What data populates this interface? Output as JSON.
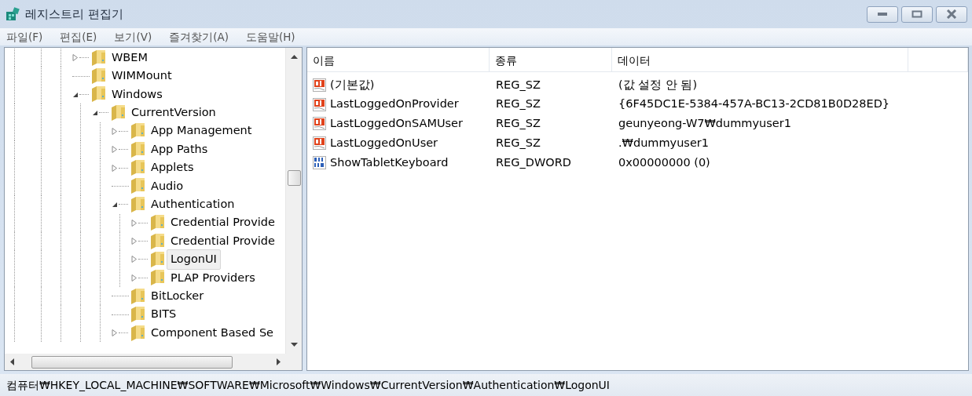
{
  "window": {
    "title": "레지스트리 편집기"
  },
  "menu": [
    "파일(F)",
    "편집(E)",
    "보기(V)",
    "즐겨찾기(A)",
    "도움말(H)"
  ],
  "tree": [
    {
      "label": "WBEM",
      "kind": "folder",
      "expanded": false,
      "selected": false
    },
    {
      "label": "WIMMount",
      "kind": "leaf",
      "selected": false
    },
    {
      "label": "Windows",
      "kind": "folder",
      "expanded": true,
      "selected": false,
      "children": [
        {
          "label": "CurrentVersion",
          "kind": "folder",
          "expanded": true,
          "selected": false,
          "children": [
            {
              "label": "App Management",
              "kind": "folder",
              "expanded": false,
              "selected": false
            },
            {
              "label": "App Paths",
              "kind": "folder",
              "expanded": false,
              "selected": false
            },
            {
              "label": "Applets",
              "kind": "folder",
              "expanded": false,
              "selected": false
            },
            {
              "label": "Audio",
              "kind": "leaf",
              "selected": false
            },
            {
              "label": "Authentication",
              "kind": "folder",
              "expanded": true,
              "selected": false,
              "children": [
                {
                  "label": "Credential Provide",
                  "kind": "folder",
                  "expanded": false,
                  "selected": false
                },
                {
                  "label": "Credential Provide",
                  "kind": "folder",
                  "expanded": false,
                  "selected": false
                },
                {
                  "label": "LogonUI",
                  "kind": "folder",
                  "expanded": false,
                  "selected": true
                },
                {
                  "label": "PLAP Providers",
                  "kind": "folder",
                  "expanded": false,
                  "selected": false
                }
              ]
            },
            {
              "label": "BitLocker",
              "kind": "leaf",
              "selected": false
            },
            {
              "label": "BITS",
              "kind": "leaf",
              "selected": false
            },
            {
              "label": "Component Based Se",
              "kind": "folder",
              "expanded": false,
              "selected": false
            }
          ]
        }
      ]
    }
  ],
  "values": {
    "columns": [
      "이름",
      "종류",
      "데이터"
    ],
    "rows": [
      {
        "kind": "string",
        "name": "(기본값)",
        "type": "REG_SZ",
        "data": "(값 설정 안 됨)"
      },
      {
        "kind": "string",
        "name": "LastLoggedOnProvider",
        "type": "REG_SZ",
        "data": "{6F45DC1E-5384-457A-BC13-2CD81B0D28ED}"
      },
      {
        "kind": "string",
        "name": "LastLoggedOnSAMUser",
        "type": "REG_SZ",
        "data": "geunyeong-W7₩dummyuser1"
      },
      {
        "kind": "string",
        "name": "LastLoggedOnUser",
        "type": "REG_SZ",
        "data": ".₩dummyuser1"
      },
      {
        "kind": "binary",
        "name": "ShowTabletKeyboard",
        "type": "REG_DWORD",
        "data": "0x00000000 (0)"
      }
    ]
  },
  "status_bar": "컴퓨터₩HKEY_LOCAL_MACHINE₩SOFTWARE₩Microsoft₩Windows₩CurrentVersion₩Authentication₩LogonUI"
}
